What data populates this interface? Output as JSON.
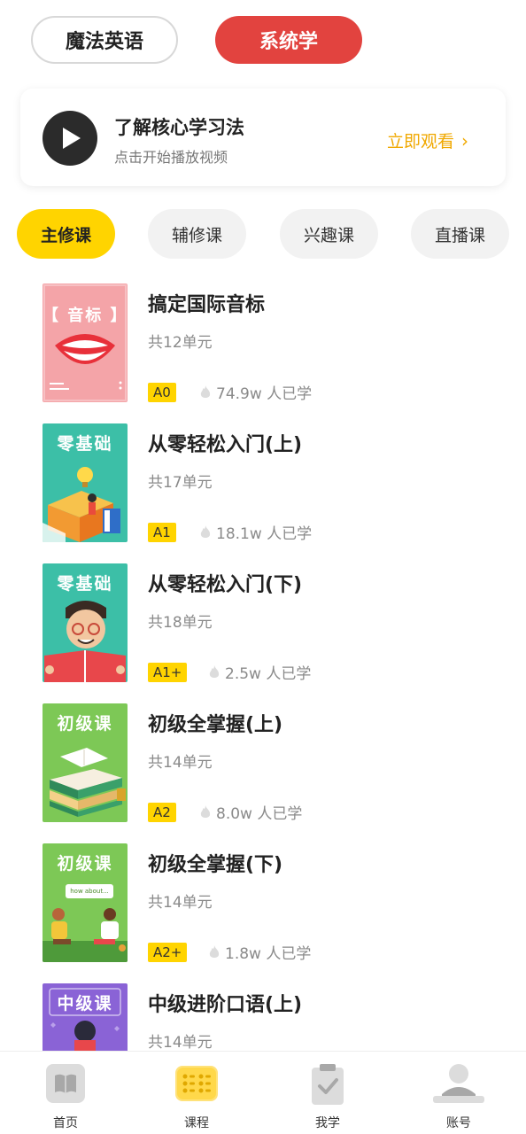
{
  "top_toggle": {
    "magic_english": "魔法英语",
    "systematic": "系统学"
  },
  "video_card": {
    "title": "了解核心学习法",
    "subtitle": "点击开始播放视频",
    "watch_now": "立即观看",
    "watch_chevron": "›"
  },
  "categories": [
    {
      "label": "主修课",
      "active": true
    },
    {
      "label": "辅修课",
      "active": false
    },
    {
      "label": "兴趣课",
      "active": false
    },
    {
      "label": "直播课",
      "active": false
    }
  ],
  "courses": [
    {
      "cover_label": "【 音标 】",
      "title": "搞定国际音标",
      "units": "共12单元",
      "level": "A0",
      "learners": "74.9w 人已学"
    },
    {
      "cover_label": "零基础",
      "title": "从零轻松入门(上)",
      "units": "共17单元",
      "level": "A1",
      "learners": "18.1w 人已学"
    },
    {
      "cover_label": "零基础",
      "title": "从零轻松入门(下)",
      "units": "共18单元",
      "level": "A1+",
      "learners": "2.5w 人已学"
    },
    {
      "cover_label": "初级课",
      "title": "初级全掌握(上)",
      "units": "共14单元",
      "level": "A2",
      "learners": "8.0w 人已学"
    },
    {
      "cover_label": "初级课",
      "cover_bubble": "how about...",
      "title": "初级全掌握(下)",
      "units": "共14单元",
      "level": "A2+",
      "learners": "1.8w 人已学"
    },
    {
      "cover_label": "中级课",
      "title": "中级进阶口语(上)",
      "units": "共14单元"
    }
  ],
  "bottom_nav": [
    {
      "label": "首页",
      "icon": "book-icon"
    },
    {
      "label": "课程",
      "icon": "course-grid-icon",
      "active": true
    },
    {
      "label": "我学",
      "icon": "clipboard-check-icon"
    },
    {
      "label": "账号",
      "icon": "user-icon"
    }
  ],
  "colors": {
    "accent_red": "#e2433f",
    "accent_yellow": "#ffd400",
    "watch_orange": "#f0a800"
  }
}
